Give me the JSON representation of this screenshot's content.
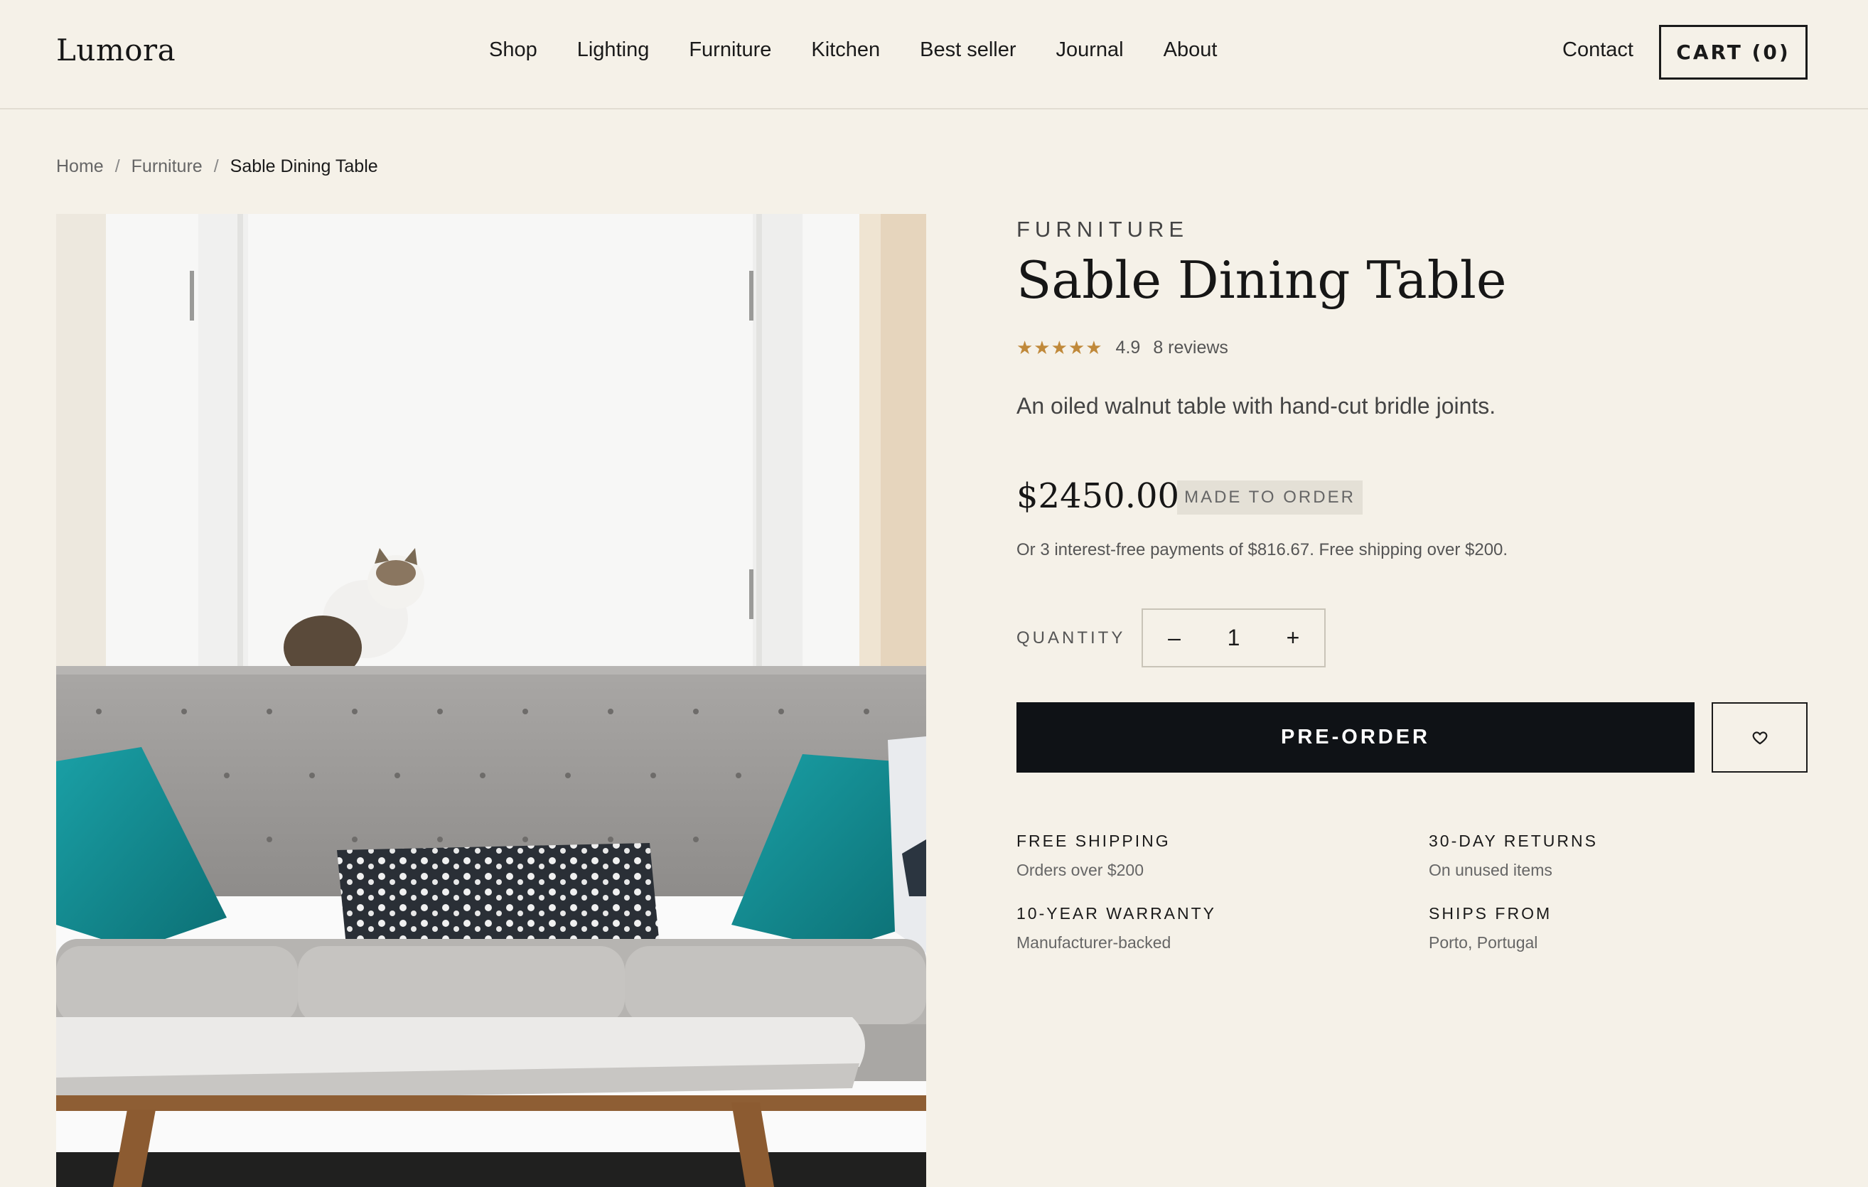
{
  "header": {
    "logo": "Lumora",
    "nav": [
      "Shop",
      "Lighting",
      "Furniture",
      "Kitchen",
      "Best seller",
      "Journal",
      "About"
    ],
    "contact": "Contact",
    "cart": "CART (0)"
  },
  "breadcrumb": {
    "items": [
      "Home",
      "Furniture"
    ],
    "separator": "/",
    "current": "Sable Dining Table"
  },
  "product": {
    "category": "FURNITURE",
    "title": "Sable Dining Table",
    "stars": "★★★★★",
    "rating": "4.9",
    "reviews": "8 reviews",
    "tagline": "An oiled walnut table with hand-cut bridle joints.",
    "price": "$2450.00",
    "badge": "MADE TO ORDER",
    "installments": "Or 3 interest-free payments of $816.67. Free shipping over $200.",
    "quantity_label": "QUANTITY",
    "quantity": "1",
    "minus": "–",
    "plus": "+",
    "cta": "PRE-ORDER",
    "wishlist_icon": "heart-icon"
  },
  "features": [
    {
      "title": "FREE SHIPPING",
      "sub": "Orders over $200"
    },
    {
      "title": "30-DAY RETURNS",
      "sub": "On unused items"
    },
    {
      "title": "10-YEAR WARRANTY",
      "sub": "Manufacturer-backed"
    },
    {
      "title": "SHIPS FROM",
      "sub": "Porto, Portugal"
    }
  ],
  "colors": {
    "background": "#f5f1e8",
    "accent_star": "#c0893a",
    "cta_bg": "#0f1216"
  }
}
